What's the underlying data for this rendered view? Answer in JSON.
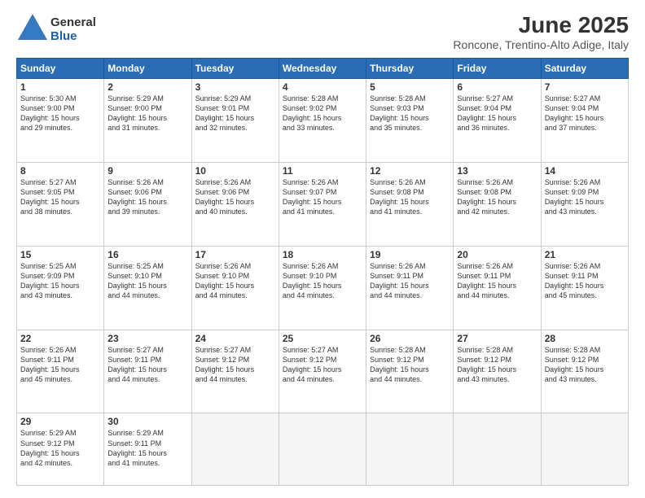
{
  "header": {
    "logo_general": "General",
    "logo_blue": "Blue",
    "month_title": "June 2025",
    "location": "Roncone, Trentino-Alto Adige, Italy"
  },
  "calendar": {
    "days_of_week": [
      "Sunday",
      "Monday",
      "Tuesday",
      "Wednesday",
      "Thursday",
      "Friday",
      "Saturday"
    ],
    "weeks": [
      [
        null,
        {
          "day": 2,
          "sunrise": "5:29 AM",
          "sunset": "9:00 PM",
          "daylight": "15 hours and 31 minutes."
        },
        {
          "day": 3,
          "sunrise": "5:29 AM",
          "sunset": "9:01 PM",
          "daylight": "15 hours and 32 minutes."
        },
        {
          "day": 4,
          "sunrise": "5:28 AM",
          "sunset": "9:02 PM",
          "daylight": "15 hours and 33 minutes."
        },
        {
          "day": 5,
          "sunrise": "5:28 AM",
          "sunset": "9:03 PM",
          "daylight": "15 hours and 35 minutes."
        },
        {
          "day": 6,
          "sunrise": "5:27 AM",
          "sunset": "9:04 PM",
          "daylight": "15 hours and 36 minutes."
        },
        {
          "day": 7,
          "sunrise": "5:27 AM",
          "sunset": "9:04 PM",
          "daylight": "15 hours and 37 minutes."
        }
      ],
      [
        {
          "day": 8,
          "sunrise": "5:27 AM",
          "sunset": "9:05 PM",
          "daylight": "15 hours and 38 minutes."
        },
        {
          "day": 9,
          "sunrise": "5:26 AM",
          "sunset": "9:06 PM",
          "daylight": "15 hours and 39 minutes."
        },
        {
          "day": 10,
          "sunrise": "5:26 AM",
          "sunset": "9:06 PM",
          "daylight": "15 hours and 40 minutes."
        },
        {
          "day": 11,
          "sunrise": "5:26 AM",
          "sunset": "9:07 PM",
          "daylight": "15 hours and 41 minutes."
        },
        {
          "day": 12,
          "sunrise": "5:26 AM",
          "sunset": "9:08 PM",
          "daylight": "15 hours and 41 minutes."
        },
        {
          "day": 13,
          "sunrise": "5:26 AM",
          "sunset": "9:08 PM",
          "daylight": "15 hours and 42 minutes."
        },
        {
          "day": 14,
          "sunrise": "5:26 AM",
          "sunset": "9:09 PM",
          "daylight": "15 hours and 43 minutes."
        }
      ],
      [
        {
          "day": 15,
          "sunrise": "5:25 AM",
          "sunset": "9:09 PM",
          "daylight": "15 hours and 43 minutes."
        },
        {
          "day": 16,
          "sunrise": "5:25 AM",
          "sunset": "9:10 PM",
          "daylight": "15 hours and 44 minutes."
        },
        {
          "day": 17,
          "sunrise": "5:26 AM",
          "sunset": "9:10 PM",
          "daylight": "15 hours and 44 minutes."
        },
        {
          "day": 18,
          "sunrise": "5:26 AM",
          "sunset": "9:10 PM",
          "daylight": "15 hours and 44 minutes."
        },
        {
          "day": 19,
          "sunrise": "5:26 AM",
          "sunset": "9:11 PM",
          "daylight": "15 hours and 44 minutes."
        },
        {
          "day": 20,
          "sunrise": "5:26 AM",
          "sunset": "9:11 PM",
          "daylight": "15 hours and 44 minutes."
        },
        {
          "day": 21,
          "sunrise": "5:26 AM",
          "sunset": "9:11 PM",
          "daylight": "15 hours and 45 minutes."
        }
      ],
      [
        {
          "day": 22,
          "sunrise": "5:26 AM",
          "sunset": "9:11 PM",
          "daylight": "15 hours and 45 minutes."
        },
        {
          "day": 23,
          "sunrise": "5:27 AM",
          "sunset": "9:11 PM",
          "daylight": "15 hours and 44 minutes."
        },
        {
          "day": 24,
          "sunrise": "5:27 AM",
          "sunset": "9:12 PM",
          "daylight": "15 hours and 44 minutes."
        },
        {
          "day": 25,
          "sunrise": "5:27 AM",
          "sunset": "9:12 PM",
          "daylight": "15 hours and 44 minutes."
        },
        {
          "day": 26,
          "sunrise": "5:28 AM",
          "sunset": "9:12 PM",
          "daylight": "15 hours and 44 minutes."
        },
        {
          "day": 27,
          "sunrise": "5:28 AM",
          "sunset": "9:12 PM",
          "daylight": "15 hours and 43 minutes."
        },
        {
          "day": 28,
          "sunrise": "5:28 AM",
          "sunset": "9:12 PM",
          "daylight": "15 hours and 43 minutes."
        }
      ],
      [
        {
          "day": 29,
          "sunrise": "5:29 AM",
          "sunset": "9:12 PM",
          "daylight": "15 hours and 42 minutes."
        },
        {
          "day": 30,
          "sunrise": "5:29 AM",
          "sunset": "9:11 PM",
          "daylight": "15 hours and 41 minutes."
        },
        null,
        null,
        null,
        null,
        null
      ]
    ],
    "week1_day1": {
      "day": 1,
      "sunrise": "5:30 AM",
      "sunset": "9:00 PM",
      "daylight": "15 hours and 29 minutes."
    }
  }
}
